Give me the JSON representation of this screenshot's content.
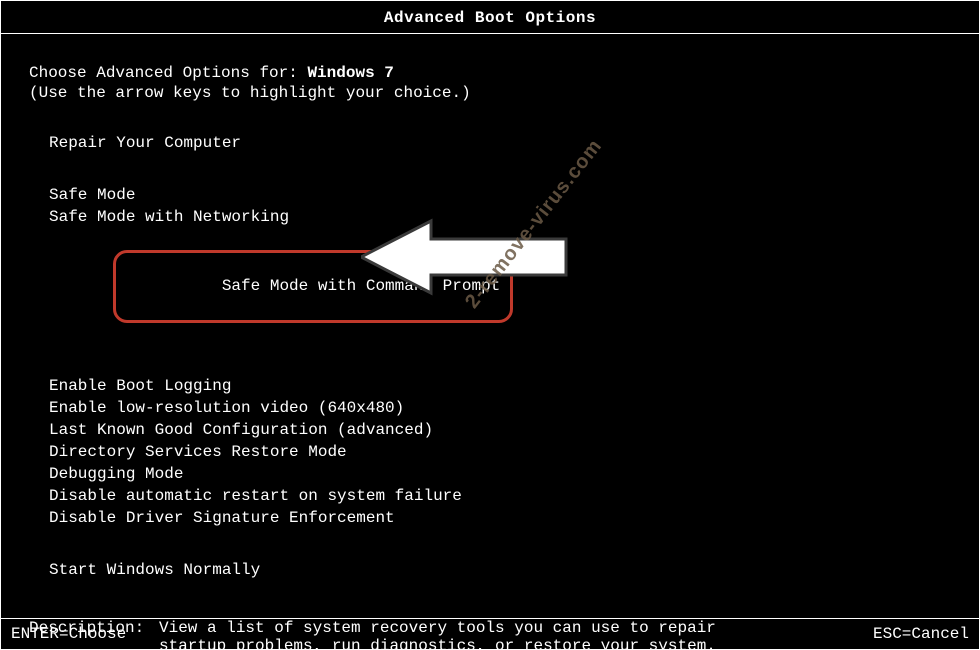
{
  "title": "Advanced Boot Options",
  "prompt": {
    "prefix": "Choose Advanced Options for: ",
    "os": "Windows 7",
    "help": "(Use the arrow keys to highlight your choice.)"
  },
  "menu": {
    "group1": [
      "Repair Your Computer"
    ],
    "group2": [
      "Safe Mode",
      "Safe Mode with Networking",
      "Safe Mode with Command Prompt"
    ],
    "selected_index": 2,
    "group3": [
      "Enable Boot Logging",
      "Enable low-resolution video (640x480)",
      "Last Known Good Configuration (advanced)",
      "Directory Services Restore Mode",
      "Debugging Mode",
      "Disable automatic restart on system failure",
      "Disable Driver Signature Enforcement"
    ],
    "group4": [
      "Start Windows Normally"
    ]
  },
  "description": {
    "label": "Description:",
    "text": "View a list of system recovery tools you can use to repair startup problems, run diagnostics, or restore your system."
  },
  "footer": {
    "enter": "ENTER=Choose",
    "esc": "ESC=Cancel"
  },
  "watermark": "2-remove-virus.com",
  "colors": {
    "highlight_border": "#c0392b",
    "watermark_color": "#6b5a46"
  }
}
